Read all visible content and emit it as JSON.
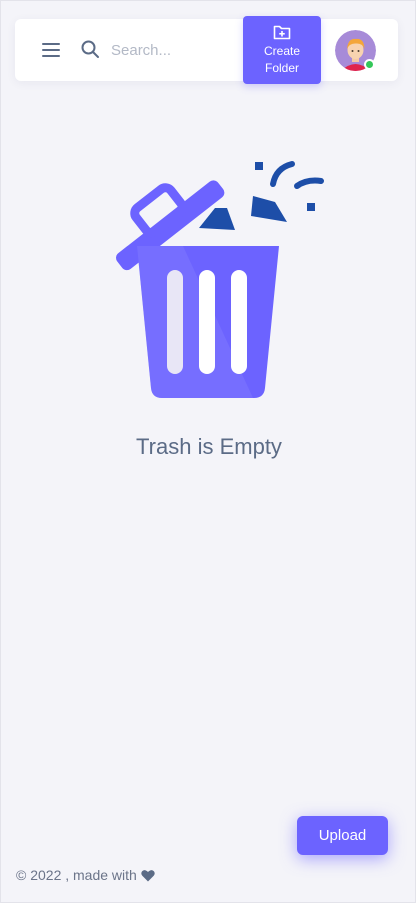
{
  "header": {
    "menu_icon": "hamburger-menu-icon",
    "search_icon": "search-icon",
    "search": {
      "placeholder": "Search..."
    },
    "create_folder": {
      "icon": "folder-plus-icon",
      "line1": "Create",
      "line2": "Folder"
    },
    "user": {
      "status": "online"
    }
  },
  "main": {
    "illustration": "trash-can-illustration",
    "empty_message": "Trash is Empty"
  },
  "actions": {
    "upload_label": "Upload"
  },
  "footer": {
    "copyright": "© 2022 , made with",
    "heart_icon": "heart-icon"
  },
  "colors": {
    "accent": "#6c63ff",
    "background": "#f4f4f9",
    "text": "#5b6b86",
    "online": "#34c759",
    "debris": "#1d4ea8"
  }
}
